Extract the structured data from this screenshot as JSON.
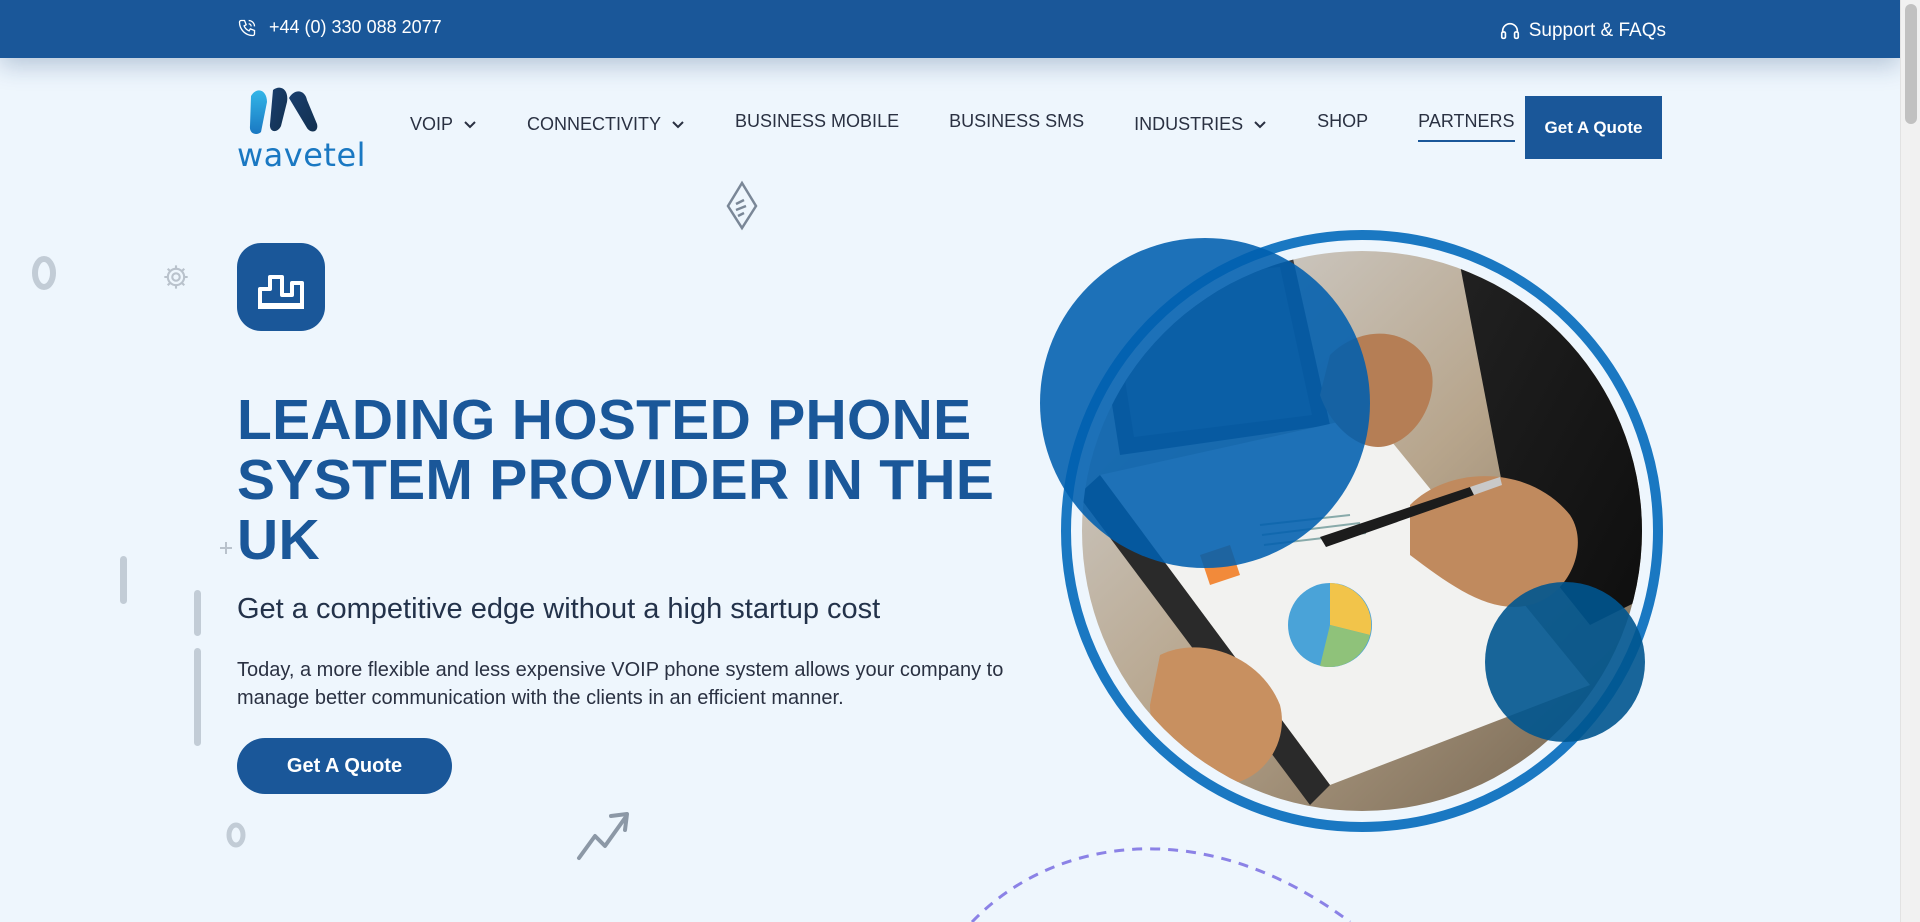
{
  "topbar": {
    "phone": "+44 (0) 330 088 2077",
    "support": "Support & FAQs",
    "phone_icon": "phone-icon",
    "support_icon": "headset-icon"
  },
  "brand": {
    "logo_text": "wavetel"
  },
  "nav": {
    "items": [
      {
        "label": "VOIP",
        "has_dropdown": true
      },
      {
        "label": "CONNECTIVITY",
        "has_dropdown": true
      },
      {
        "label": "BUSINESS MOBILE",
        "has_dropdown": false
      },
      {
        "label": "BUSINESS SMS",
        "has_dropdown": false
      },
      {
        "label": "INDUSTRIES",
        "has_dropdown": true
      },
      {
        "label": "SHOP",
        "has_dropdown": false
      },
      {
        "label": "PARTNERS",
        "has_dropdown": false,
        "active": true
      }
    ],
    "cta_label": "Get A Quote"
  },
  "hero": {
    "title": "LEADING HOSTED PHONE SYSTEM PROVIDER IN THE UK",
    "subtitle": "Get a competitive edge without a high startup cost",
    "description": "Today, a more flexible and less expensive VOIP phone system allows your company to manage better communication with the clients in an efficient manner.",
    "cta_label": "Get A Quote",
    "icon": "bar-chart-icon"
  },
  "colors": {
    "brand_blue": "#1a5799",
    "accent_blue": "#1a78c2",
    "background": "#eef6fd"
  }
}
